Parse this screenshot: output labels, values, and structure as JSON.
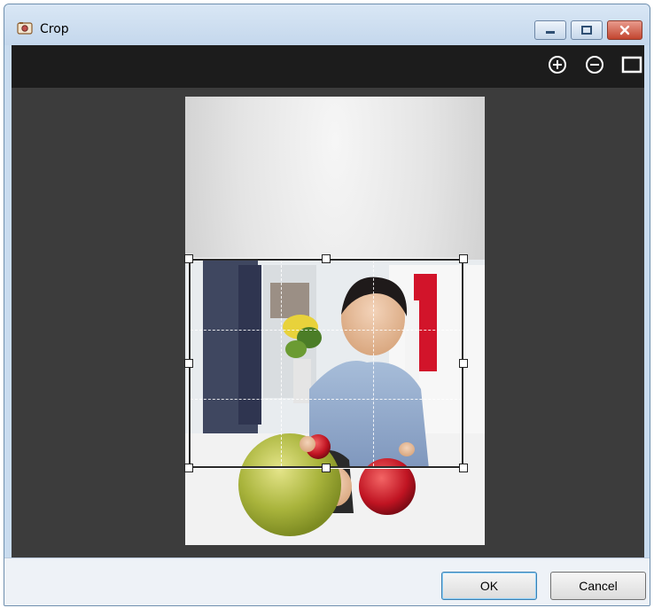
{
  "window": {
    "title": "Crop",
    "controls": {
      "minimize": "minimize-icon",
      "maximize": "maximize-icon",
      "close": "close-icon"
    }
  },
  "toolbar": {
    "zoom_in_icon": "zoom-in-icon",
    "zoom_out_icon": "zoom-out-icon",
    "fit_icon": "fit-to-window-icon"
  },
  "footer": {
    "ok_label": "OK",
    "cancel_label": "Cancel"
  },
  "colors": {
    "toolbar_bg": "#1c1c1c",
    "canvas_bg": "#3c3c3c",
    "close_button": "#c2452f"
  }
}
